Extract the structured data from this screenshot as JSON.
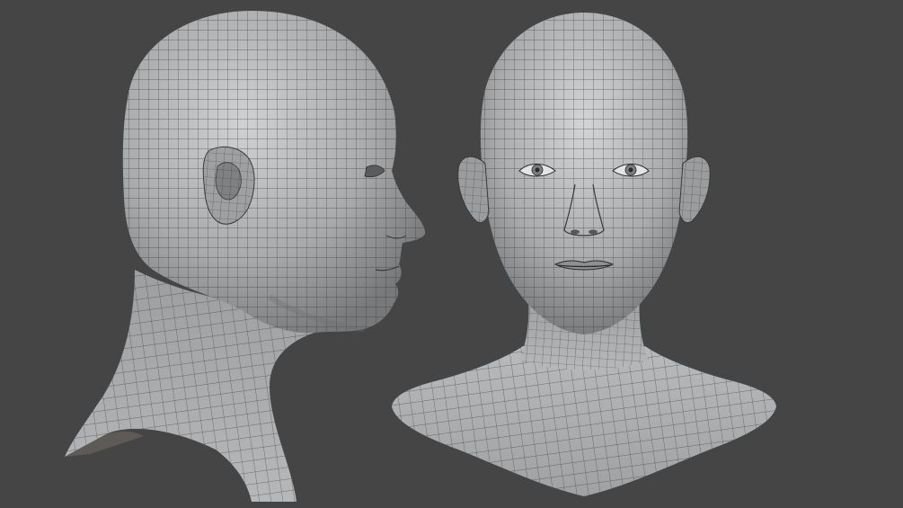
{
  "scene": {
    "background_color": "#454545",
    "mesh_fill": "#a7a9ab",
    "mesh_fill_light": "#c6c8ca",
    "mesh_fill_dark": "#6f7173",
    "wire_color": "#2c2c2c",
    "views": [
      {
        "name": "side-view-head"
      },
      {
        "name": "front-view-head"
      }
    ]
  }
}
